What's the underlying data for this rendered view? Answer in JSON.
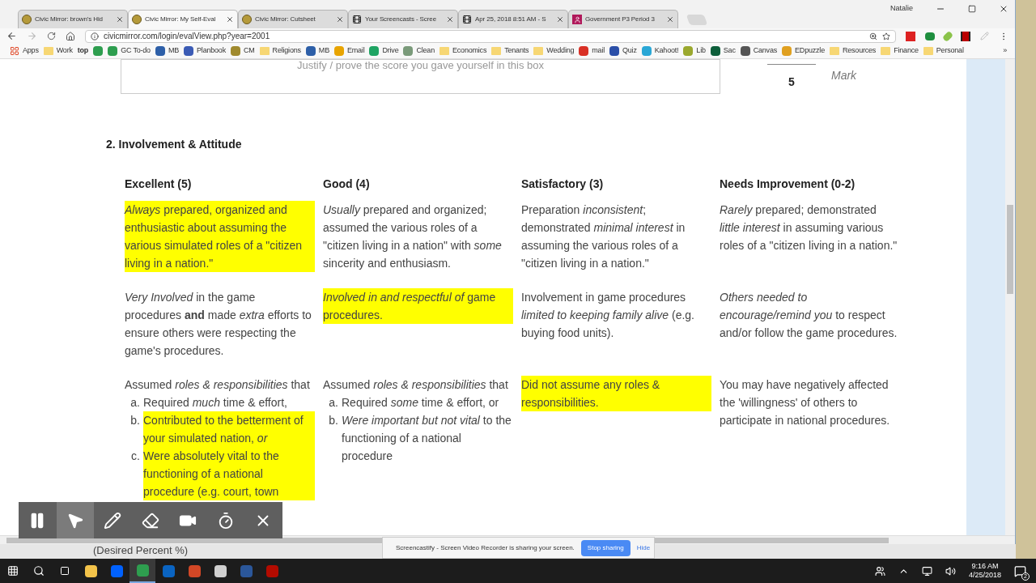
{
  "browser": {
    "profile": "Natalie",
    "tabs": [
      {
        "title": "Civic Mirror: brown's Hid",
        "kind": "site",
        "selected": false
      },
      {
        "title": "Civic Mirror: My Self-Eval",
        "kind": "site",
        "selected": true
      },
      {
        "title": "Civic Mirror: Cutsheet",
        "kind": "site",
        "selected": false
      },
      {
        "title": "Your Screencasts - Scree",
        "kind": "film",
        "selected": false
      },
      {
        "title": "Apr 25, 2018 8:51 AM - S",
        "kind": "film",
        "selected": false
      },
      {
        "title": "Government P3 Period 3",
        "kind": "classroom",
        "selected": false
      }
    ],
    "url": "civicmirror.com/login/evalView.php?year=2001",
    "bookmarks": [
      {
        "kind": "apps",
        "label": "Apps"
      },
      {
        "kind": "folder",
        "label": "Work"
      },
      {
        "kind": "logo",
        "label": "top"
      },
      {
        "kind": "site",
        "color": "#2e9e4f"
      },
      {
        "kind": "site",
        "color": "#2e9e4f",
        "label": "GC To-do"
      },
      {
        "kind": "site",
        "color": "#2d5fa8",
        "label": "MB"
      },
      {
        "kind": "site",
        "color": "#3b5bb5",
        "label": "Planbook"
      },
      {
        "kind": "site",
        "color": "#a08a2e",
        "label": "CM"
      },
      {
        "kind": "folder",
        "label": "Religions"
      },
      {
        "kind": "site",
        "color": "#2d5fa8",
        "label": "MB"
      },
      {
        "kind": "site",
        "color": "#e8a400",
        "label": "Email"
      },
      {
        "kind": "site",
        "color": "#1fa463",
        "label": "Drive"
      },
      {
        "kind": "site",
        "color": "#7a9a7a",
        "label": "Clean"
      },
      {
        "kind": "folder",
        "label": "Economics"
      },
      {
        "kind": "folder",
        "label": "Tenants"
      },
      {
        "kind": "folder",
        "label": "Wedding"
      },
      {
        "kind": "site",
        "color": "#d93025",
        "label": "mail"
      },
      {
        "kind": "site",
        "color": "#2b4fa8",
        "label": "Quiz"
      },
      {
        "kind": "site",
        "color": "#2aa7d6",
        "label": "Kahoot!"
      },
      {
        "kind": "site",
        "color": "#9aa82e",
        "label": "Lib"
      },
      {
        "kind": "site",
        "color": "#0d5e3a",
        "label": "Sac"
      },
      {
        "kind": "site",
        "color": "#555555",
        "label": "Canvas"
      },
      {
        "kind": "site",
        "color": "#e0a020",
        "label": "EDpuzzle"
      },
      {
        "kind": "folder",
        "label": "Resources"
      },
      {
        "kind": "folder",
        "label": "Finance"
      },
      {
        "kind": "folder",
        "label": "Personal"
      }
    ],
    "more_bookmarks": "»"
  },
  "page": {
    "justify_box": {
      "placeholder": "Justify / prove the score you gave yourself in this box"
    },
    "score": "5",
    "score_label": "Mark",
    "section_title": "2. Involvement & Attitude",
    "columns": [
      "Excellent (5)",
      "Good (4)",
      "Satisfactory (3)",
      "Needs Improvement (0-2)"
    ],
    "rows": [
      [
        {
          "kind": "text",
          "highlighted": true,
          "text": "*Always* prepared, organized and enthusiastic about assuming the various simulated roles of a \"citizen living in a nation.\""
        },
        {
          "kind": "text",
          "highlighted": false,
          "text": "*Usually* prepared and organized; assumed the various roles of a \"citizen living in a nation\" with *some* sincerity and enthusiasm."
        },
        {
          "kind": "text",
          "highlighted": false,
          "text": "Preparation *inconsistent*; demonstrated *minimal interest* in assuming the various roles of a \"citizen living in a nation.\""
        },
        {
          "kind": "text",
          "highlighted": false,
          "text": "*Rarely* prepared; demonstrated *little interest* in assuming various roles of a \"citizen living in a nation.\""
        }
      ],
      [
        {
          "kind": "text",
          "highlighted": false,
          "text": "*Very Involved* in the game procedures **and** made *extra* efforts to ensure others were respecting the game's procedures."
        },
        {
          "kind": "text",
          "highlighted": true,
          "text": "*Involved in and respectful of* game procedures."
        },
        {
          "kind": "text",
          "highlighted": false,
          "text": "Involvement in game procedures *limited to keeping family alive* (e.g. buying food units)."
        },
        {
          "kind": "text",
          "highlighted": false,
          "text": "*Others needed to encourage/remind you* to respect and/or follow the game procedures."
        }
      ],
      [
        {
          "kind": "list",
          "intro": "Assumed *roles & responsibilities* that",
          "items": [
            {
              "marker": "a.",
              "text": "Required *much* time & effort,",
              "highlighted": false
            },
            {
              "marker": "b.",
              "text": "Contributed to the betterment of your simulated nation, *or*",
              "highlighted": true
            },
            {
              "marker": "c.",
              "text": "Were absolutely vital to the functioning of a national procedure (e.g. court, town",
              "highlighted": true
            }
          ]
        },
        {
          "kind": "list",
          "intro": "Assumed *roles & responsibilities* that",
          "items": [
            {
              "marker": "a.",
              "text": "Required *some* time & effort, or",
              "highlighted": false
            },
            {
              "marker": "b.",
              "text": "*Were important but not vital* to the functioning of a national procedure",
              "highlighted": false
            }
          ]
        },
        {
          "kind": "text",
          "highlighted": true,
          "text": "Did not assume any roles & responsibilities."
        },
        {
          "kind": "text",
          "highlighted": false,
          "text": "You may have negatively affected the 'willingness' of others to participate in national procedures."
        }
      ]
    ]
  },
  "recorder_toolbar": [
    {
      "kind": "pause",
      "selected": false
    },
    {
      "kind": "pointer",
      "selected": true
    },
    {
      "kind": "pen",
      "selected": false
    },
    {
      "kind": "eraser",
      "selected": false
    },
    {
      "kind": "camera",
      "selected": false
    },
    {
      "kind": "timer",
      "selected": false
    },
    {
      "kind": "close",
      "selected": false
    }
  ],
  "sharing_bar": {
    "message": "Screencastify - Screen Video Recorder is sharing your screen.",
    "stop_button": "Stop sharing",
    "hide_button": "Hide"
  },
  "background_window": {
    "text": "(Desired Percent %)"
  },
  "taskbar": {
    "apps": [
      {
        "kind": "explorer",
        "selected": false
      },
      {
        "kind": "dropbox",
        "selected": false
      },
      {
        "kind": "chrome",
        "selected": true
      },
      {
        "kind": "outlook",
        "selected": false
      },
      {
        "kind": "powerpoint",
        "selected": false
      },
      {
        "kind": "paint",
        "selected": false
      },
      {
        "kind": "word",
        "selected": false
      },
      {
        "kind": "acrobat",
        "selected": false
      }
    ],
    "time": "9:16 AM",
    "date": "4/25/2018",
    "notifications": "2"
  }
}
